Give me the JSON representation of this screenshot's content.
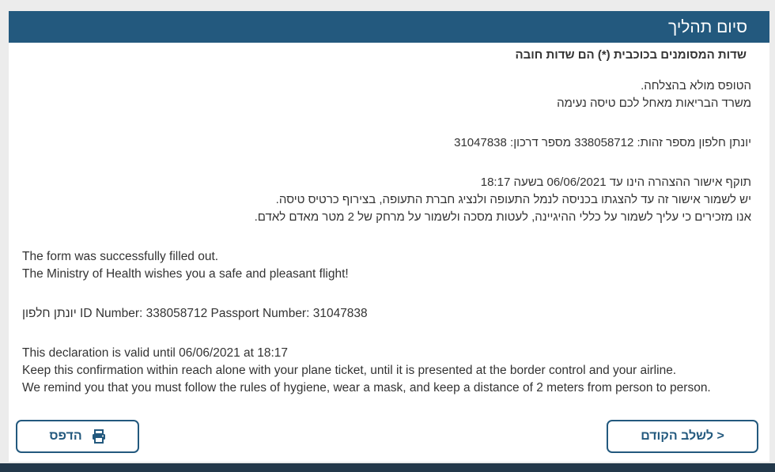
{
  "header": {
    "title": "סיום תהליך"
  },
  "required_note": "שדות המסומנים בכוכבית (*) הם שדות חובה",
  "hebrew": {
    "success_line1": "הטופס מולא בהצלחה.",
    "success_line2": "משרד הבריאות מאחל לכם טיסה נעימה",
    "identity_line": "יונתן חלפון מספר זהות: 338058712 מספר דרכון: 31047838",
    "validity_line1": "תוקף אישור ההצהרה הינו עד 06/06/2021 בשעה 18:17",
    "validity_line2": "יש לשמור אישור זה עד להצגתו בכניסה לנמל התעופה ולנציג חברת התעופה, בצירוף כרטיס טיסה.",
    "validity_line3": "אנו מזכירים כי עליך לשמור על כללי ההיגיינה, לעטות מסכה ולשמור על מרחק של 2 מטר מאדם לאדם."
  },
  "english": {
    "success_line1": "The form was successfully filled out.",
    "success_line2": "The Ministry of Health wishes you a safe and pleasant flight!",
    "identity_line": "יונתן חלפון ID Number: 338058712 Passport Number: 31047838",
    "validity_line1": "This declaration is valid until 06/06/2021 at 18:17",
    "validity_line2": "Keep this confirmation within reach alone with your plane ticket, until it is presented at the border control and your airline.",
    "validity_line3": "We remind you that you must follow the rules of hygiene, wear a mask, and keep a distance of 2 meters from person to person."
  },
  "buttons": {
    "print_label": "הדפס",
    "print_icon": "printer-icon",
    "back_label": "< לשלב הקודם"
  },
  "colors": {
    "primary": "#23597e",
    "footer": "#23384a",
    "text": "#333333"
  }
}
